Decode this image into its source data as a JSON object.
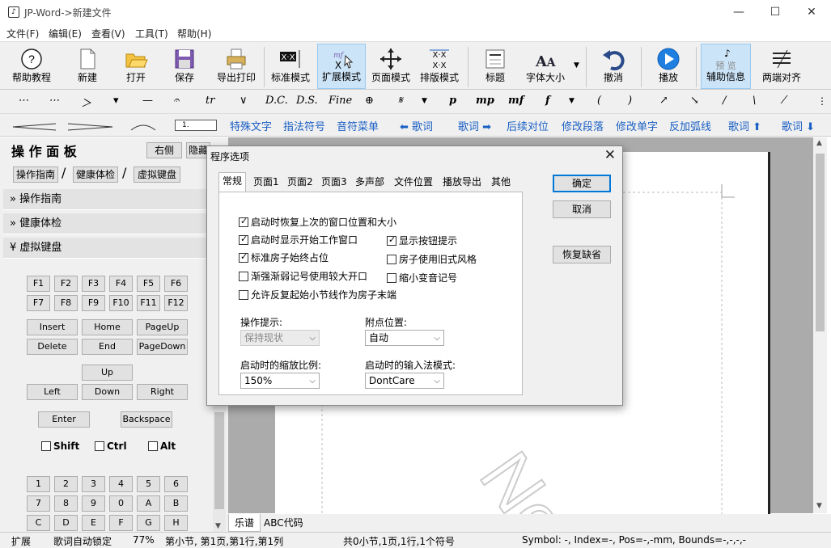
{
  "window": {
    "title": "JP-Word->新建文件",
    "minimize": "—",
    "maximize": "☐",
    "close": "✕"
  },
  "menu": [
    "文件(F)",
    "编辑(E)",
    "查看(V)",
    "工具(T)",
    "帮助(H)"
  ],
  "toolbar1": [
    "帮助教程",
    "新建",
    "打开",
    "保存",
    "导出打印",
    "标准模式",
    "扩展模式",
    "页面模式",
    "排版模式",
    "标题",
    "字体大小",
    "撤消",
    "播放",
    "辅助信息",
    "两端对齐"
  ],
  "toolbar1_preview": "预 览",
  "toolbar2_glyphs": [
    "⋯",
    "⋯",
    "＞",
    "▾",
    "—",
    "𝄐",
    "tr",
    "∨",
    "D.C.",
    "D.S.",
    "Fine",
    "⊕",
    "𝄋",
    "p",
    "mp",
    "mf",
    "f",
    "(",
    ")",
    "↗",
    "↘",
    "/",
    "\\",
    "⁄"
  ],
  "toolbar3": {
    "field": "1.",
    "links": [
      "特殊文字",
      "指法符号",
      "音符菜单",
      "⬅ 歌词",
      "歌词 ➡",
      "后续对位",
      "修改段落",
      "修改单字",
      "反加弧线",
      "歌词 ⬆",
      "歌词 ⬇"
    ]
  },
  "panel": {
    "title": "操 作 面 板",
    "right_btn": "右侧",
    "hide_btn": "隐藏",
    "tabs": [
      "操作指南",
      "健康体检",
      "虚拟键盘"
    ],
    "sections": [
      {
        "label": "» 操作指南"
      },
      {
        "label": "» 健康体检"
      },
      {
        "label": "¥ 虚拟键盘"
      }
    ],
    "fkeys1": [
      "F1",
      "F2",
      "F3",
      "F4",
      "F5",
      "F6"
    ],
    "fkeys2": [
      "F7",
      "F8",
      "F9",
      "F10",
      "F11",
      "F12"
    ],
    "nav1": [
      "Insert",
      "Home",
      "PageUp"
    ],
    "nav2": [
      "Delete",
      "End",
      "PageDown"
    ],
    "arrows": {
      "up": "Up",
      "left": "Left",
      "down": "Down",
      "right": "Right"
    },
    "enter": "Enter",
    "backspace": "Backspace",
    "mods": [
      "Shift",
      "Ctrl",
      "Alt"
    ],
    "num1": [
      "1",
      "2",
      "3",
      "4",
      "5",
      "6"
    ],
    "num2": [
      "7",
      "8",
      "9",
      "0",
      "A",
      "B"
    ],
    "num3": [
      "C",
      "D",
      "E",
      "F",
      "G",
      "H"
    ]
  },
  "bottom_tabs": [
    "乐谱",
    "ABC代码"
  ],
  "status": {
    "mode": "扩展",
    "lyric": "歌词自动锁定",
    "zoom": "77%",
    "position": "第小节, 第1页,第1行,第1列",
    "summary": "共0小节,1页,1行,1个符号",
    "symbol": "Symbol: -, Index=-, Pos=-,-mm, Bounds=-,-,-,-"
  },
  "dialog": {
    "title": "程序选项",
    "close": "✕",
    "tabs": [
      "常规",
      "页面1",
      "页面2",
      "页面3",
      "多声部",
      "文件位置",
      "播放导出",
      "其他"
    ],
    "checks": [
      {
        "label": "启动时恢复上次的窗口位置和大小",
        "checked": true
      },
      {
        "label": "启动时显示开始工作窗口",
        "checked": true
      },
      {
        "label": "显示按钮提示",
        "checked": true
      },
      {
        "label": "标准房子始终占位",
        "checked": true
      },
      {
        "label": "房子使用旧式风格",
        "checked": false
      },
      {
        "label": "渐强渐弱记号使用较大开口",
        "checked": false
      },
      {
        "label": "缩小变音记号",
        "checked": false
      },
      {
        "label": "允许反复起始小节线作为房子末端",
        "checked": false
      }
    ],
    "op_hint_label": "操作提示:",
    "op_hint_value": "保持现状",
    "attach_label": "附点位置:",
    "attach_value": "自动",
    "zoom_label": "启动时的缩放比例:",
    "zoom_value": "150%",
    "ime_label": "启动时的输入法模式:",
    "ime_value": "DontCare",
    "buttons": {
      "ok": "确定",
      "cancel": "取消",
      "restore": "恢复缺省"
    }
  }
}
